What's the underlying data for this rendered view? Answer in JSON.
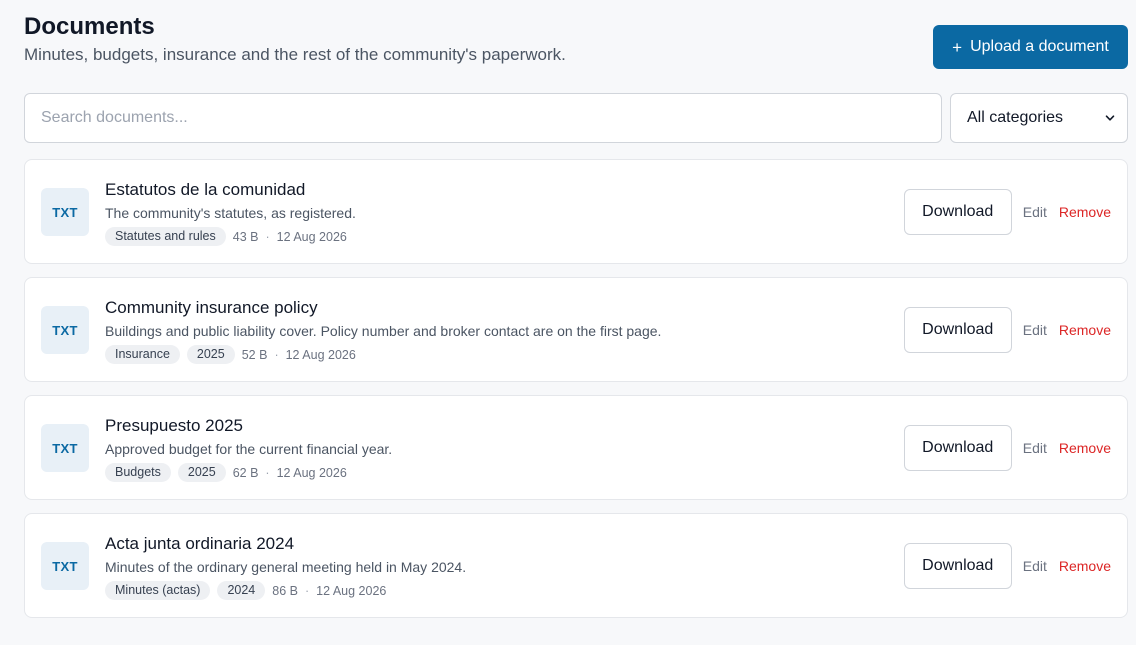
{
  "header": {
    "title": "Documents",
    "subtitle": "Minutes, budgets, insurance and the rest of the community's paperwork.",
    "upload_icon": "+",
    "upload_label": "Upload a document"
  },
  "search": {
    "placeholder": "Search documents...",
    "value": ""
  },
  "filter": {
    "selected": "All categories"
  },
  "labels": {
    "download": "Download",
    "edit": "Edit",
    "remove": "Remove",
    "separator": "·"
  },
  "colors": {
    "accent": "#0b69a3",
    "danger": "#dc2626"
  },
  "documents": [
    {
      "type": "TXT",
      "title": "Estatutos de la comunidad",
      "description": "The community's statutes, as registered.",
      "tags": [
        "Statutes and rules"
      ],
      "size": "43 B",
      "date": "12 Aug 2026"
    },
    {
      "type": "TXT",
      "title": "Community insurance policy",
      "description": "Buildings and public liability cover. Policy number and broker contact are on the first page.",
      "tags": [
        "Insurance",
        "2025"
      ],
      "size": "52 B",
      "date": "12 Aug 2026"
    },
    {
      "type": "TXT",
      "title": "Presupuesto 2025",
      "description": "Approved budget for the current financial year.",
      "tags": [
        "Budgets",
        "2025"
      ],
      "size": "62 B",
      "date": "12 Aug 2026"
    },
    {
      "type": "TXT",
      "title": "Acta junta ordinaria 2024",
      "description": "Minutes of the ordinary general meeting held in May 2024.",
      "tags": [
        "Minutes (actas)",
        "2024"
      ],
      "size": "86 B",
      "date": "12 Aug 2026"
    }
  ]
}
